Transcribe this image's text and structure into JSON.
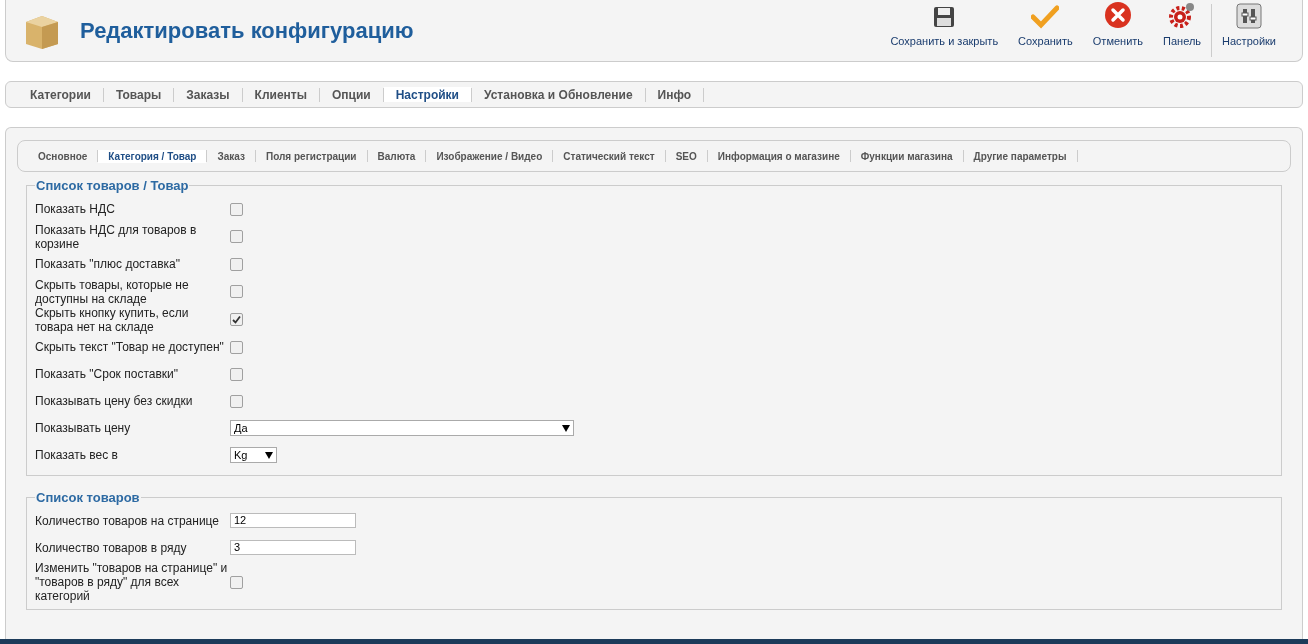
{
  "header": {
    "title": "Редактировать конфигурацию",
    "toolbar": [
      {
        "kind": "save-close",
        "label": "Сохранить и закрыть"
      },
      {
        "kind": "save",
        "label": "Сохранить"
      },
      {
        "kind": "cancel",
        "label": "Отменить"
      },
      {
        "kind": "panel",
        "label": "Панель"
      },
      {
        "kind": "settings",
        "label": "Настройки"
      }
    ]
  },
  "main_tabs": [
    {
      "label": "Категории",
      "selected": false
    },
    {
      "label": "Товары",
      "selected": false
    },
    {
      "label": "Заказы",
      "selected": false
    },
    {
      "label": "Клиенты",
      "selected": false
    },
    {
      "label": "Опции",
      "selected": false
    },
    {
      "label": "Настройки",
      "selected": true
    },
    {
      "label": "Установка и Обновление",
      "selected": false
    },
    {
      "label": "Инфо",
      "selected": false
    }
  ],
  "sub_tabs": [
    {
      "label": "Основное",
      "selected": false
    },
    {
      "label": "Категория / Товар",
      "selected": true
    },
    {
      "label": "Заказ",
      "selected": false
    },
    {
      "label": "Поля регистрации",
      "selected": false
    },
    {
      "label": "Валюта",
      "selected": false
    },
    {
      "label": "Изображение / Видео",
      "selected": false
    },
    {
      "label": "Статический текст",
      "selected": false
    },
    {
      "label": "SEO",
      "selected": false
    },
    {
      "label": "Информация о магазине",
      "selected": false
    },
    {
      "label": "Функции магазина",
      "selected": false
    },
    {
      "label": "Другие параметры",
      "selected": false
    }
  ],
  "sections": [
    {
      "title": "Список товаров / Товар",
      "fields": [
        {
          "kind": "checkbox",
          "label": "Показать НДС",
          "checked": false
        },
        {
          "kind": "checkbox",
          "label": "Показать НДС для товаров в корзине",
          "checked": false
        },
        {
          "kind": "checkbox",
          "label": "Показать \"плюс доставка\"",
          "checked": false
        },
        {
          "kind": "checkbox",
          "label": "Скрыть товары, которые не доступны на складе",
          "checked": false
        },
        {
          "kind": "checkbox",
          "label": "Скрыть кнопку купить, если товара нет на складе",
          "checked": true
        },
        {
          "kind": "checkbox",
          "label": "Скрыть текст \"Товар не доступен\"",
          "checked": false
        },
        {
          "kind": "checkbox",
          "label": "Показать \"Срок поставки\"",
          "checked": false
        },
        {
          "kind": "checkbox",
          "label": "Показывать цену без скидки",
          "checked": false
        },
        {
          "kind": "wide-select",
          "label": "Показывать цену",
          "value": "Да"
        },
        {
          "kind": "short-select",
          "label": "Показать вес в",
          "value": "Kg"
        }
      ]
    },
    {
      "title": "Список товаров",
      "fields": [
        {
          "kind": "text",
          "label": "Количество товаров на странице",
          "value": "12"
        },
        {
          "kind": "text",
          "label": "Количество товаров в ряду",
          "value": "3"
        },
        {
          "kind": "checkbox",
          "label": "Изменить \"товаров на странице\" и \"товаров в ряду\" для всех категорий",
          "checked": false
        }
      ]
    }
  ]
}
